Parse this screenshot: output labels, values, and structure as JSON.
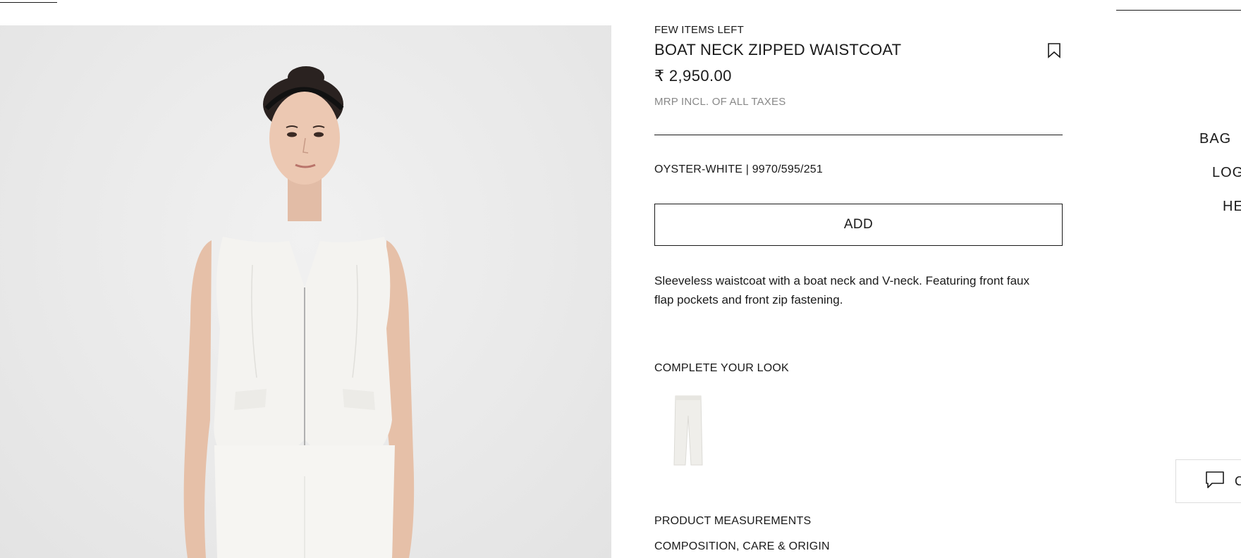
{
  "product": {
    "stock_status": "FEW ITEMS LEFT",
    "title": "BOAT NECK ZIPPED WAISTCOAT",
    "price": "₹ 2,950.00",
    "tax_note": "MRP INCL. OF ALL TAXES",
    "color_reference": "OYSTER-WHITE | 9970/595/251",
    "add_label": "ADD",
    "description": "Sleeveless waistcoat with a boat neck and V-neck. Featuring front faux flap pockets and front zip fastening."
  },
  "complete_look": {
    "heading": "COMPLETE YOUR LOOK"
  },
  "details": {
    "measurements": "PRODUCT MEASUREMENTS",
    "composition": "COMPOSITION, CARE & ORIGIN"
  },
  "nav": {
    "bag": "BAG",
    "login": "LOG",
    "help": "HE"
  },
  "chat": {
    "label": "C"
  },
  "icons": {
    "wishlist": "bookmark-icon",
    "chat": "chat-bubble-icon",
    "bag": "bag-icon"
  },
  "colors": {
    "text": "#1a1a1a",
    "muted": "#888888",
    "image_bg": "#ebebeb"
  }
}
